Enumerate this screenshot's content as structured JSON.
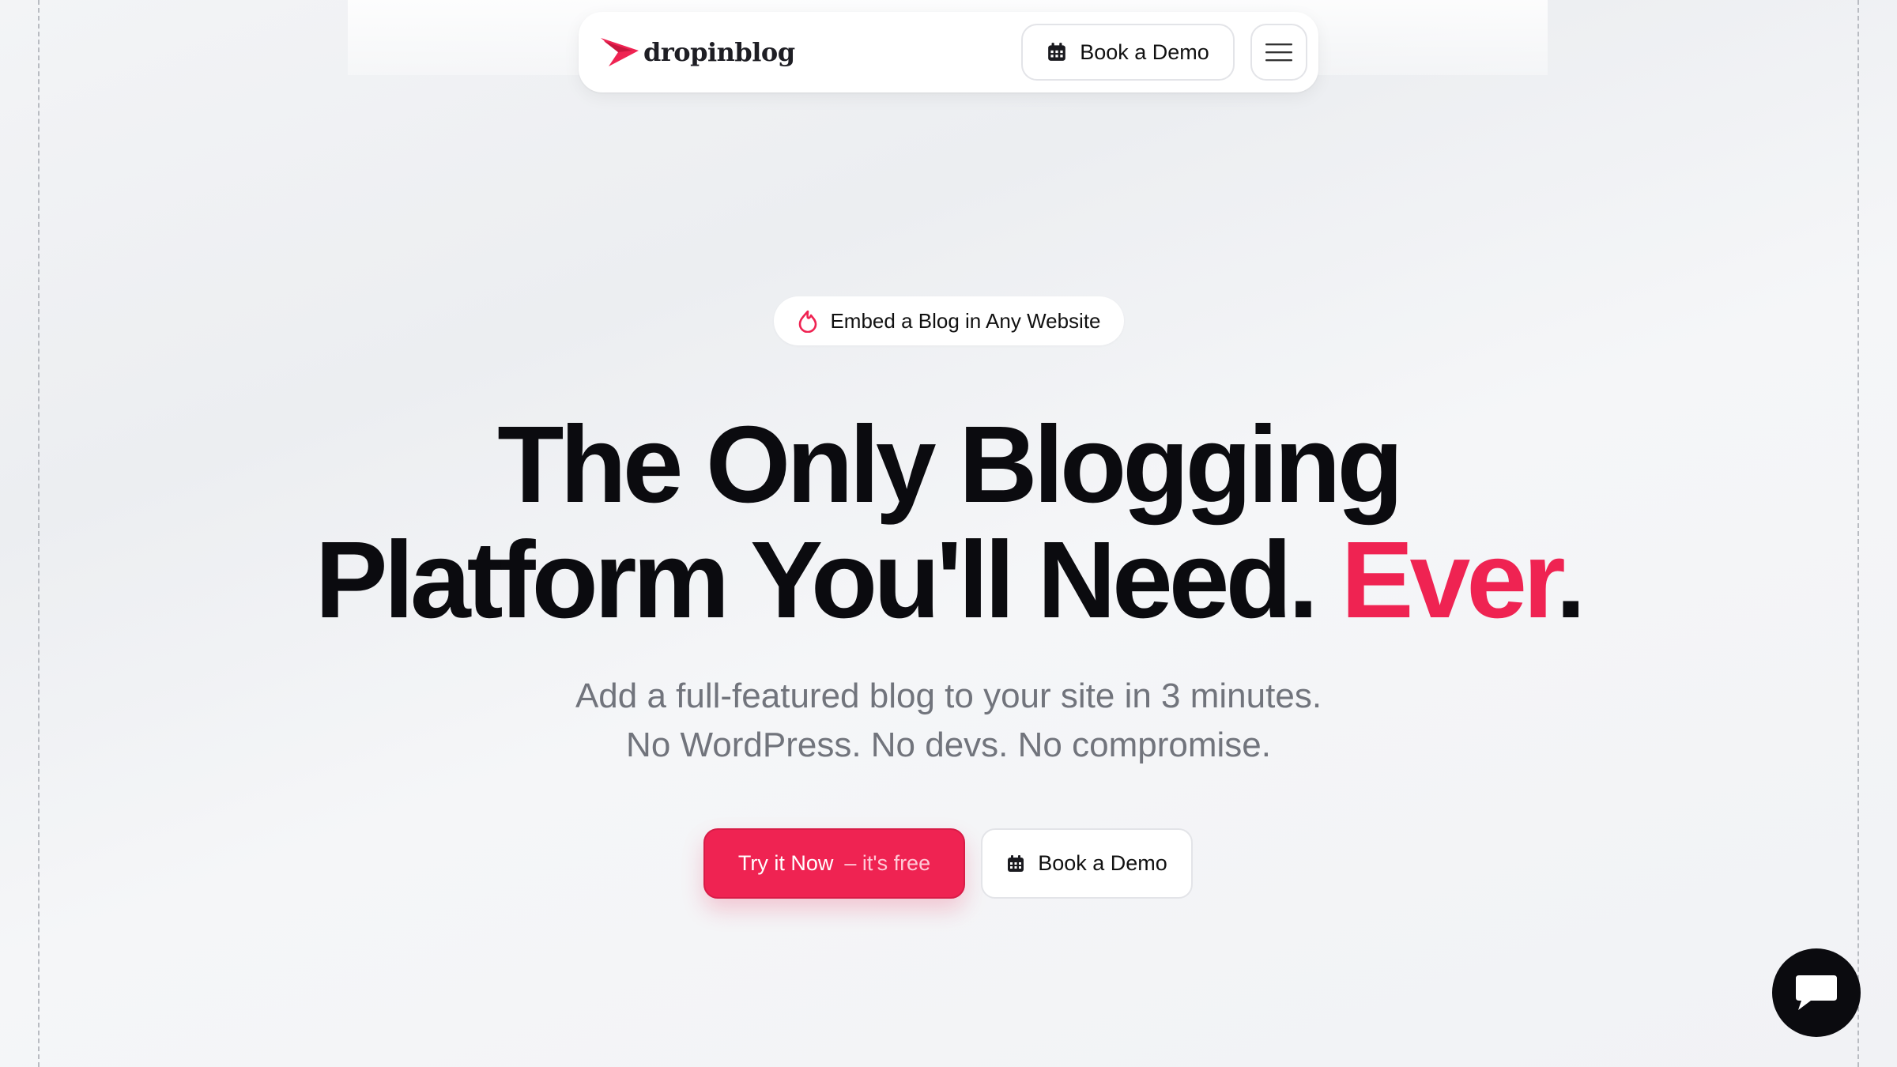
{
  "brand": {
    "name": "dropinblog",
    "accent_color": "#ef2352"
  },
  "nav": {
    "demo_label": "Book a Demo",
    "demo_icon": "calendar-icon",
    "menu_icon": "hamburger-menu-icon"
  },
  "hero": {
    "badge_icon": "flame-icon",
    "badge_text": "Embed a Blog in Any Website",
    "headline_line1": "The Only Blogging",
    "headline_line2": "Platform You'll Need.",
    "headline_accent": "Ever",
    "headline_period": ".",
    "sub_line1": "Add a full-featured blog to your site in 3 minutes.",
    "sub_line2": "No WordPress. No devs. No compromise."
  },
  "cta": {
    "primary_label": "Try it Now",
    "primary_suffix": "– it's free",
    "secondary_label": "Book a Demo",
    "secondary_icon": "calendar-icon"
  },
  "chat": {
    "icon": "chat-bubble-icon"
  }
}
